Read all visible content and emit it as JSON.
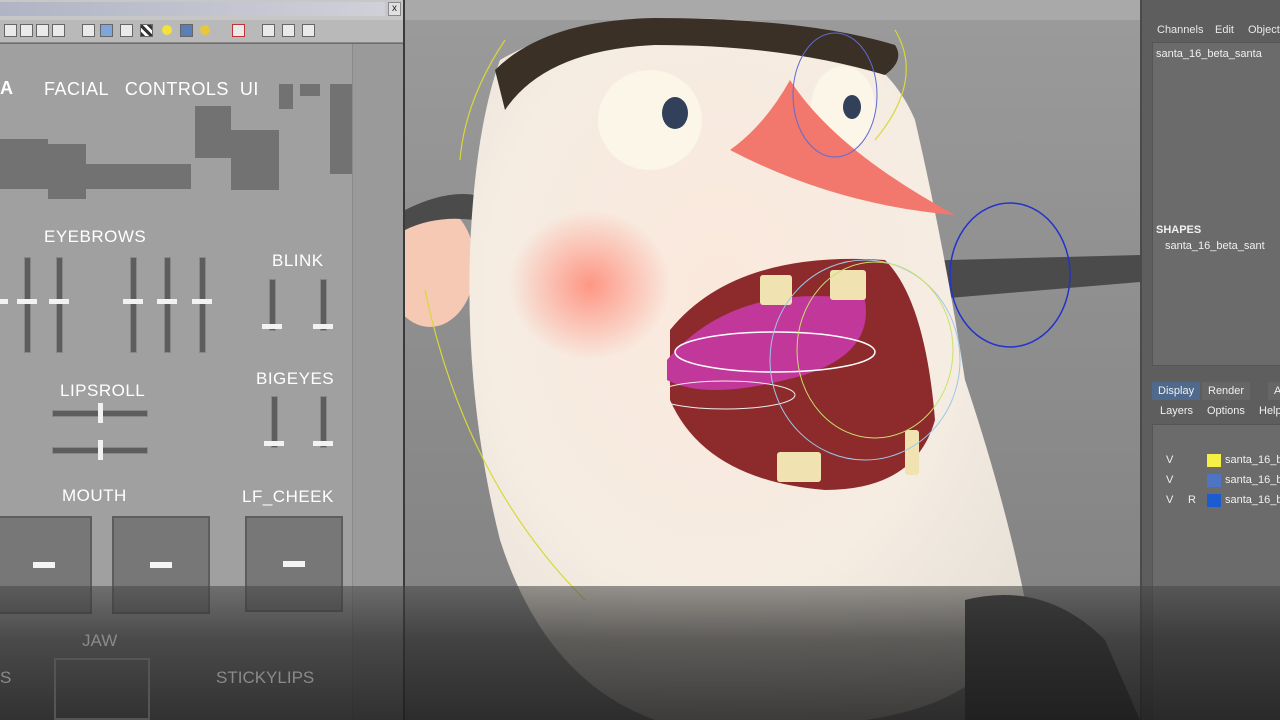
{
  "left_panel": {
    "close_glyph": "x",
    "header_fragment": "A",
    "header_title": "FACIAL   CONTROLS  UI",
    "eyebrows_label": "EYEBROWS",
    "blink_label": "BLINK",
    "lipsroll_label": "LIPSROLL",
    "bigeyes_label": "BIGEYES",
    "mouth_label": "MOUTH",
    "lf_cheek_label": "LF_CHEEK",
    "jaw_label": "JAW",
    "stickylips_label": "STICKYLIPS",
    "fragment_s": "S"
  },
  "right_panel": {
    "menu": [
      "Channels",
      "Edit",
      "Object"
    ],
    "object_name": "santa_16_beta_santa",
    "shapes_heading": "SHAPES",
    "shapes_item": "santa_16_beta_sant",
    "tabs": [
      "Display",
      "Render",
      "A"
    ],
    "submenu": [
      "Layers",
      "Options",
      "Help"
    ],
    "layers": [
      {
        "v": "V",
        "r": "",
        "color": "#f4f046",
        "name": "santa_16_b"
      },
      {
        "v": "V",
        "r": "",
        "color": "#4e75c4",
        "name": "santa_16_b"
      },
      {
        "v": "V",
        "r": "R",
        "color": "#1d5bd1",
        "name": "santa_16_b"
      }
    ]
  },
  "icons": [
    "close-icon",
    "grid-icon",
    "cube-icon",
    "light-icon",
    "camera-icon",
    "select-icon"
  ]
}
